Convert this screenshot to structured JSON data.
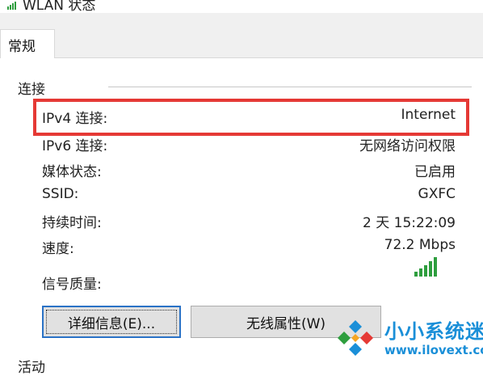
{
  "window": {
    "title": "WLAN 状态"
  },
  "tabs": [
    {
      "label": "常规"
    }
  ],
  "connection": {
    "group_label": "连接",
    "rows": [
      {
        "label": "IPv4 连接:",
        "value": "Internet"
      },
      {
        "label": "IPv6 连接:",
        "value": "无网络访问权限"
      },
      {
        "label": "媒体状态:",
        "value": "已启用"
      },
      {
        "label": "SSID:",
        "value": "GXFC"
      },
      {
        "label": "持续时间:",
        "value": "2 天 15:22:09"
      },
      {
        "label": "速度:",
        "value": "72.2 Mbps"
      }
    ],
    "signal_label": "信号质量:",
    "signal_level": {
      "bars": 5,
      "max": 5
    }
  },
  "buttons": {
    "details": "详细信息(E)...",
    "wireless_props": "无线属性(W)"
  },
  "activity": {
    "group_label": "活动"
  },
  "watermark": {
    "brand": "小小系统迷",
    "url": "www.ilovext.com"
  },
  "colors": {
    "highlight": "#e53935",
    "signal": "#2e9e3e",
    "watermark": "#1a8fd8",
    "button_focus": "#2a72c6"
  }
}
